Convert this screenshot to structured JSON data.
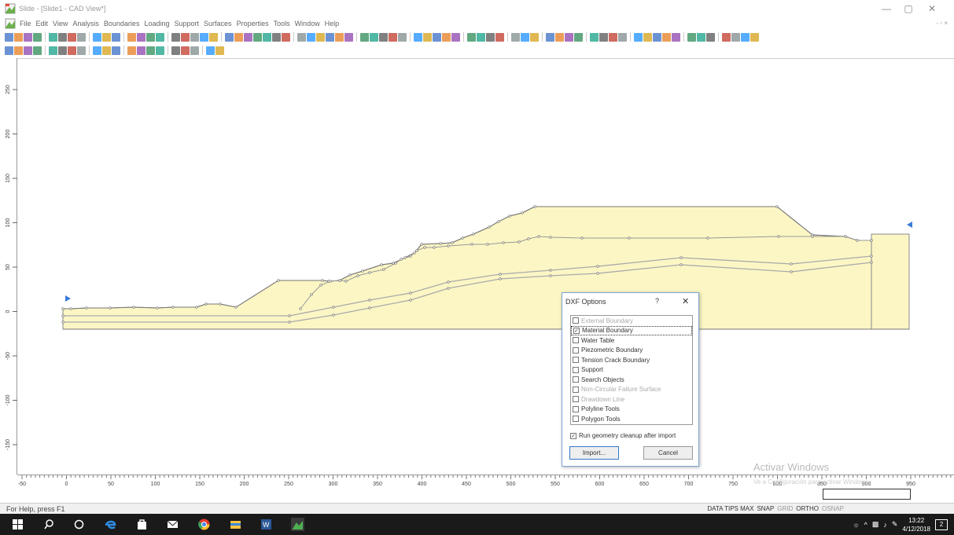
{
  "window": {
    "title": "Slide - [Slide1 - CAD View*]",
    "controls": [
      "—",
      "▢",
      "✕"
    ],
    "mdi_controls": "- ▫ ×"
  },
  "menu": [
    "File",
    "Edit",
    "View",
    "Analysis",
    "Boundaries",
    "Loading",
    "Support",
    "Surfaces",
    "Properties",
    "Tools",
    "Window",
    "Help"
  ],
  "vruler_ticks": [
    "250",
    "200",
    "150",
    "100",
    "50",
    "0",
    "-50",
    "-100",
    "-150"
  ],
  "hruler_ticks": [
    "-50",
    "0",
    "50",
    "100",
    "150",
    "200",
    "250",
    "300",
    "350",
    "400",
    "450",
    "500",
    "550",
    "600",
    "650",
    "700",
    "750",
    "800",
    "850",
    "900",
    "950"
  ],
  "dialog": {
    "title": "DXF Options",
    "help": "?",
    "close": "✕",
    "items": [
      {
        "label": "External Boundary",
        "checked": false,
        "enabled": false
      },
      {
        "label": "Material Boundary",
        "checked": true,
        "enabled": true,
        "selected": true
      },
      {
        "label": "Water Table",
        "checked": false,
        "enabled": true
      },
      {
        "label": "Piezometric Boundary",
        "checked": false,
        "enabled": true
      },
      {
        "label": "Tension Crack Boundary",
        "checked": false,
        "enabled": true
      },
      {
        "label": "Support",
        "checked": false,
        "enabled": true
      },
      {
        "label": "Search Objects",
        "checked": false,
        "enabled": true
      },
      {
        "label": "Non-Circular Failure Surface",
        "checked": false,
        "enabled": false
      },
      {
        "label": "Drawdown Line",
        "checked": false,
        "enabled": false
      },
      {
        "label": "Polyline Tools",
        "checked": false,
        "enabled": true
      },
      {
        "label": "Polygon Tools",
        "checked": false,
        "enabled": true
      }
    ],
    "cleanup_label": "Run geometry cleanup after import",
    "cleanup_checked": true,
    "import_label": "Import...",
    "cancel_label": "Cancel"
  },
  "watermark": {
    "title": "Activar Windows",
    "subtitle": "Ve a Configuración para activar Windows."
  },
  "status": {
    "help": "For Help, press F1",
    "flags": [
      {
        "label": "DATA TIPS MAX",
        "on": true
      },
      {
        "label": "SNAP",
        "on": true
      },
      {
        "label": "GRID",
        "on": false
      },
      {
        "label": "ORTHO",
        "on": true
      },
      {
        "label": "OSNAP",
        "on": false
      }
    ]
  },
  "taskbar": {
    "time": "13:22",
    "date": "4/12/2018",
    "notif_count": "2"
  },
  "colors": {
    "soil": "#fbf6c4",
    "boundary": "#888888",
    "taskbar": "#1a1a1a",
    "dialog_border": "#7aa6d8"
  }
}
